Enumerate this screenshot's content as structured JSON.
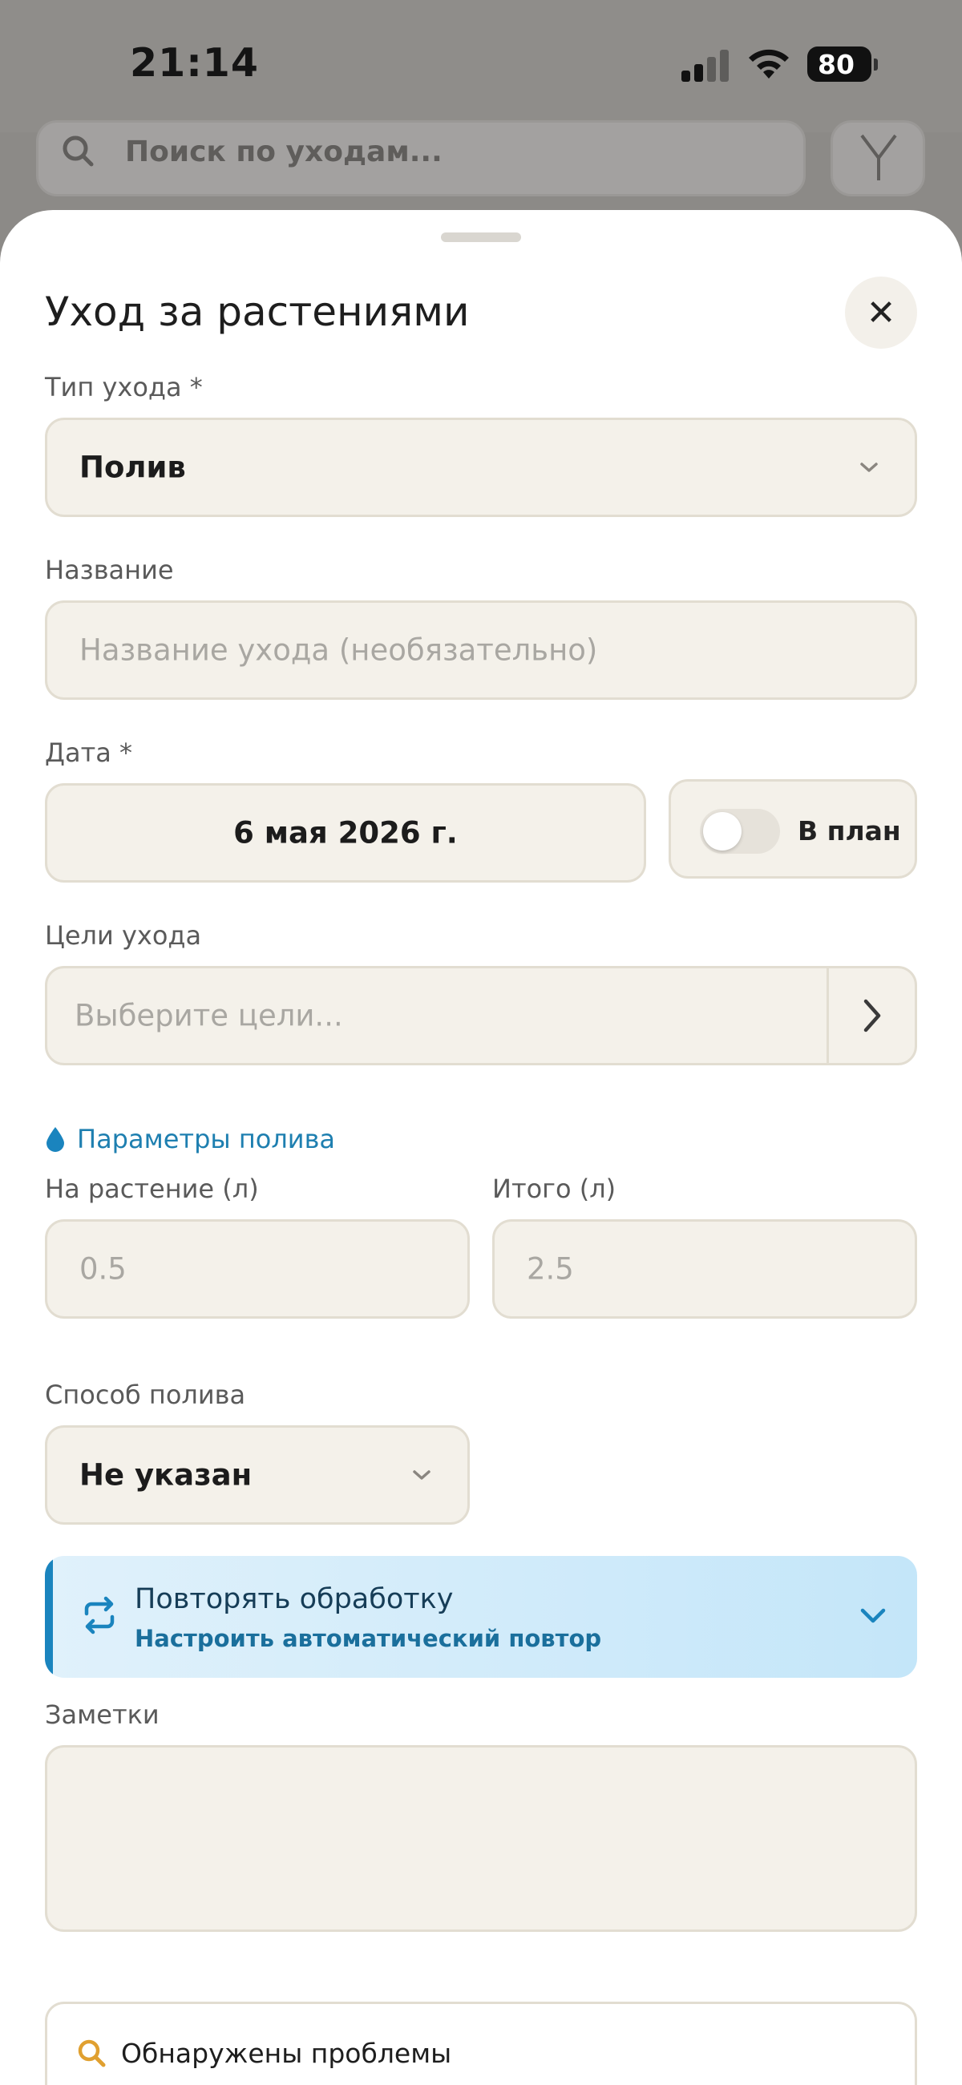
{
  "status_bar": {
    "time": "21:14",
    "battery": "80"
  },
  "background": {
    "search_placeholder": "Поиск по уходам..."
  },
  "sheet": {
    "title": "Уход за растениями",
    "care_type": {
      "label": "Тип ухода *",
      "value": "Полив"
    },
    "name": {
      "label": "Название",
      "placeholder": "Название ухода (необязательно)"
    },
    "date": {
      "label": "Дата *",
      "value": "6 мая 2026 г.",
      "plan_toggle_label": "В план",
      "plan_toggle_on": false
    },
    "goals": {
      "label": "Цели ухода",
      "placeholder": "Выберите цели..."
    },
    "watering": {
      "section_title": "Параметры полива",
      "per_plant_label": "На растение (л)",
      "per_plant_placeholder": "0.5",
      "total_label": "Итого (л)",
      "total_placeholder": "2.5",
      "method_label": "Способ полива",
      "method_value": "Не указан"
    },
    "repeat": {
      "title": "Повторять обработку",
      "subtitle": "Настроить автоматический повтор"
    },
    "notes": {
      "label": "Заметки",
      "value": ""
    },
    "problems": {
      "title": "Обнаружены проблемы"
    }
  },
  "colors": {
    "accent": "#1a84be",
    "field_bg": "#f4f1ea",
    "field_border": "#e2ddd1",
    "warning": "#e0a030"
  }
}
